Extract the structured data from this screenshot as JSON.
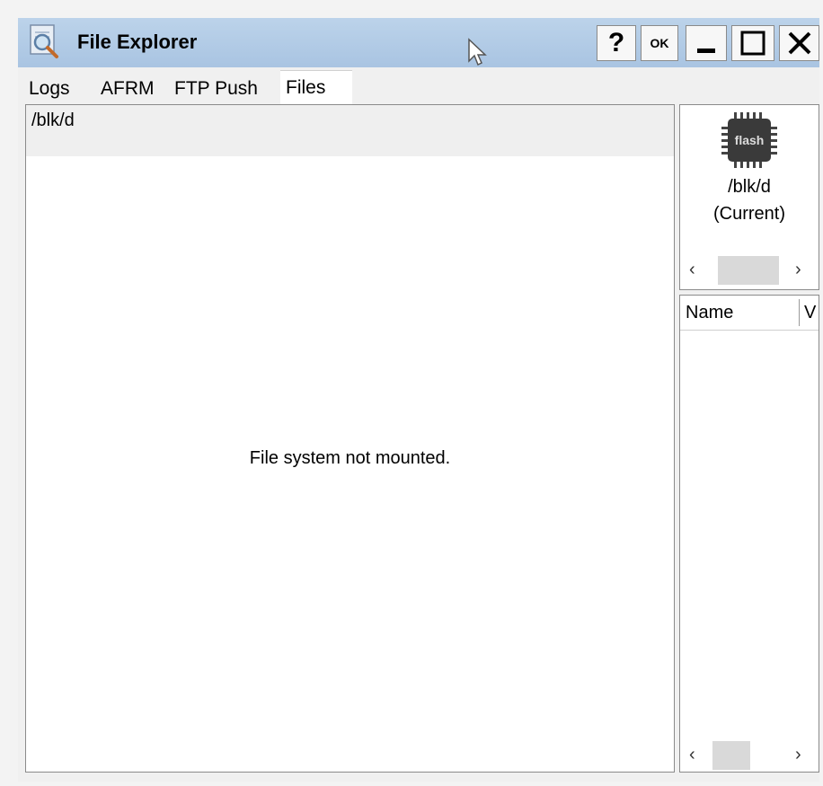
{
  "window": {
    "title": "File Explorer",
    "help_label": "?",
    "ok_label": "OK"
  },
  "tabs": [
    {
      "label": "Logs"
    },
    {
      "label": "AFRM"
    },
    {
      "label": "FTP Push"
    },
    {
      "label": "Files",
      "active": true
    }
  ],
  "main": {
    "path": "/blk/d",
    "message": "File system not mounted."
  },
  "device": {
    "chip_text": "flash",
    "path": "/blk/d",
    "status": "(Current)"
  },
  "file_list": {
    "columns": [
      "Name",
      "V"
    ]
  },
  "colors": {
    "titlebar": "#b3cce6",
    "pane_border": "#8a8a8a",
    "path_bar": "#efefef"
  }
}
